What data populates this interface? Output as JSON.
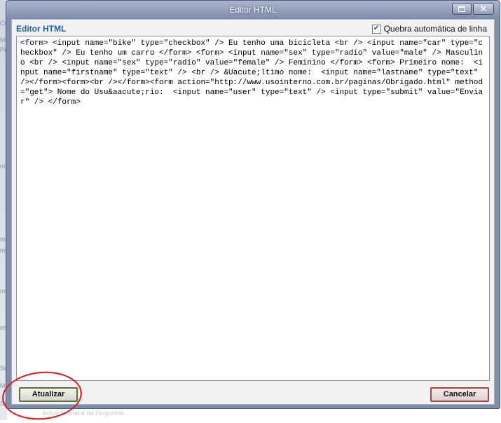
{
  "window": {
    "title": "Editor HTML"
  },
  "editor": {
    "heading": "Editor HTML",
    "wrap_label": "Quebra automática de linha",
    "wrap_checked": true,
    "content": "<form> <input name=\"bike\" type=\"checkbox\" /> Eu tenho uma bicicleta <br /> <input name=\"car\" type=\"checkbox\" /> Eu tenho um carro </form> <form> <input name=\"sex\" type=\"radio\" value=\"male\" /> Masculino <br /> <input name=\"sex\" type=\"radio\" value=\"female\" /> Feminino </form> <form> Primeiro nome:  <input name=\"firstname\" type=\"text\" /> <br /> &Uacute;ltimo nome:  <input name=\"lastname\" type=\"text\" /></form><form><br /></form><form action=\"http://www.usointerno.com.br/paginas/Obrigado.html\" method=\"get\"> Nome do Usu&aacute;rio:  <input name=\"user\" type=\"text\" /> <input type=\"submit\" value=\"Enviar\" /> </form>"
  },
  "buttons": {
    "update_label": "Atualizar",
    "cancel_label": "Cancelar"
  },
  "background": {
    "fragments": [
      "Cc",
      "M",
      "Pe",
      "m",
      "m",
      "m",
      "m",
      "ere",
      "Sn",
      "M",
      "Sir"
    ],
    "footer_text": "Incluir Prorrenit na Perguntas"
  },
  "colors": {
    "heading": "#1f5fa8",
    "annotation_circle": "#e0161c",
    "update_border": "#5f6b38",
    "cancel_border": "#a2473a"
  },
  "icons": {
    "maximize": "maximize-icon",
    "close": "close-icon",
    "checkbox": "check-icon"
  }
}
